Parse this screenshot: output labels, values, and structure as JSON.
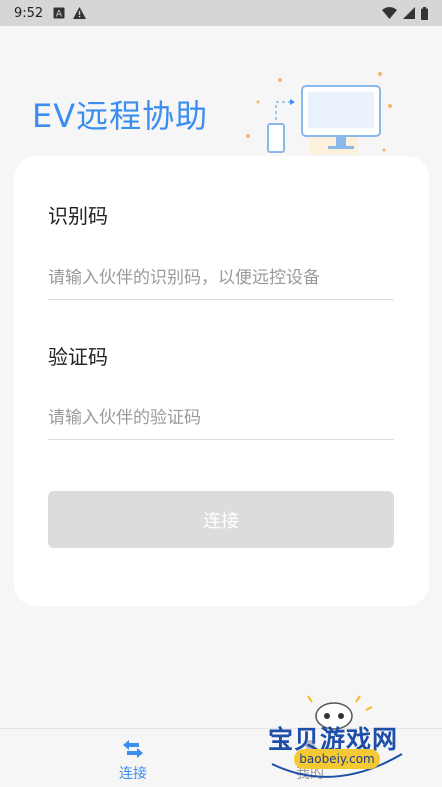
{
  "status_bar": {
    "time": "9:52",
    "left_icons": [
      "a-box-icon",
      "alert-triangle-icon"
    ],
    "right_icons": [
      "wifi-icon",
      "signal-icon",
      "battery-icon"
    ]
  },
  "header": {
    "title": "EV远程协助"
  },
  "form": {
    "id_label": "识别码",
    "id_placeholder": "请输入伙伴的识别码，以便远控设备",
    "code_label": "验证码",
    "code_placeholder": "请输入伙伴的验证码",
    "connect_button": "连接"
  },
  "bottom_nav": {
    "items": [
      {
        "label": "连接",
        "icon": "swap-arrows-icon",
        "active": true
      },
      {
        "label": "我的",
        "icon": "user-icon",
        "active": false
      }
    ]
  },
  "watermark": {
    "text": "宝贝游戏网",
    "url": "baobeiy.com"
  },
  "colors": {
    "accent": "#3b8ef0",
    "disabled_button": "#dcdcdc",
    "background": "#f6f6f6",
    "status_bar": "#d6d6d6"
  }
}
